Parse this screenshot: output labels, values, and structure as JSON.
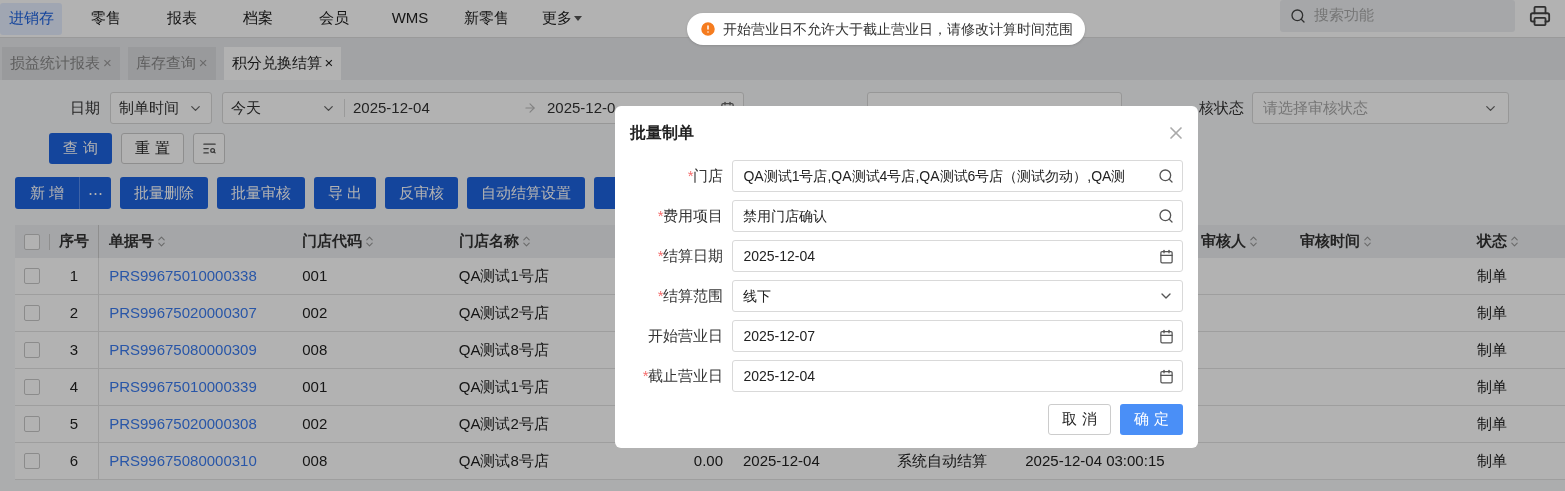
{
  "top_nav": {
    "items": [
      {
        "label": "进销存",
        "selected": true
      },
      {
        "label": "零售",
        "selected": false
      },
      {
        "label": "报表",
        "selected": false
      },
      {
        "label": "档案",
        "selected": false
      },
      {
        "label": "会员",
        "selected": false
      },
      {
        "label": "WMS",
        "selected": false
      },
      {
        "label": "新零售",
        "selected": false
      },
      {
        "label": "更多",
        "selected": false,
        "dropdown": true
      }
    ],
    "search": {
      "placeholder": "搜索功能"
    }
  },
  "tabs": [
    {
      "label": "损益统计报表",
      "close": "×",
      "selected": false
    },
    {
      "label": "库存查询",
      "close": "×",
      "selected": false
    },
    {
      "label": "积分兑换结算",
      "close": "×",
      "selected": true
    }
  ],
  "filters": {
    "date_label": "日期",
    "date_type": "制单时间",
    "range_preset": "今天",
    "start": "2025-12-04",
    "end": "2025-12-0",
    "status_label": "核状态",
    "status_placeholder": "请选择审核状态"
  },
  "filter_buttons": [
    {
      "label": "查 询",
      "kind": "primary"
    },
    {
      "label": "重 置",
      "kind": "default"
    }
  ],
  "toolbar": {
    "new": "新 增",
    "more": "⋯",
    "buttons": [
      "批量删除",
      "批量审核",
      "导 出",
      "反审核",
      "自动结算设置"
    ]
  },
  "table": {
    "header_checked": false,
    "columns": [
      {
        "label": "序号",
        "sortable": false
      },
      {
        "label": "单据号",
        "sortable": true
      },
      {
        "label": "门店代码",
        "sortable": true
      },
      {
        "label": "门店名称",
        "sortable": true
      },
      {
        "label": "审核人",
        "sortable": true
      },
      {
        "label": "审核时间",
        "sortable": true
      },
      {
        "label": "状态",
        "sortable": true
      }
    ],
    "rows": [
      {
        "checked": false,
        "no": "1",
        "doc_no": "PRS99675010000338",
        "store_code": "001",
        "store_name": "QA测试1号店",
        "status": "制单"
      },
      {
        "checked": false,
        "no": "2",
        "doc_no": "PRS99675020000307",
        "store_code": "002",
        "store_name": "QA测试2号店",
        "status": "制单"
      },
      {
        "checked": false,
        "no": "3",
        "doc_no": "PRS99675080000309",
        "store_code": "008",
        "store_name": "QA测试8号店",
        "status": "制单"
      },
      {
        "checked": false,
        "no": "4",
        "doc_no": "PRS99675010000339",
        "store_code": "001",
        "store_name": "QA测试1号店",
        "status": "制单"
      },
      {
        "checked": false,
        "no": "5",
        "doc_no": "PRS99675020000308",
        "store_code": "002",
        "store_name": "QA测试2号店",
        "status": "制单"
      },
      {
        "checked": false,
        "no": "6",
        "doc_no": "PRS99675080000310",
        "store_code": "008",
        "store_name": "QA测试8号店",
        "column_6": "0.00",
        "column_7": "2025-12-04",
        "column_8": "系统自动结算",
        "column_9": "2025-12-04 03:00:15",
        "status": "制单"
      }
    ]
  },
  "toast": {
    "message": "开始营业日不允许大于截止营业日，请修改计算时间范围"
  },
  "dialog": {
    "title": "批量制单",
    "fields": [
      {
        "label": "门店",
        "required_mark": "*",
        "kind": "search",
        "value": "QA测试1号店,QA测试4号店,QA测试6号店（测试勿动）,QA测"
      },
      {
        "label": "费用项目",
        "required_mark": "*",
        "kind": "search",
        "value": "禁用门店确认"
      },
      {
        "label": "结算日期",
        "required_mark": "*",
        "kind": "date",
        "value": "2025-12-04"
      },
      {
        "label": "结算范围",
        "required_mark": "*",
        "kind": "select",
        "value": "线下"
      },
      {
        "label": "开始营业日",
        "kind": "date",
        "value": "2025-12-07"
      },
      {
        "label": "截止营业日",
        "required_mark": "*",
        "kind": "date",
        "value": "2025-12-04"
      }
    ],
    "buttons": [
      {
        "label": "取 消",
        "kind": "default"
      },
      {
        "label": "确 定",
        "kind": "primary"
      }
    ]
  }
}
